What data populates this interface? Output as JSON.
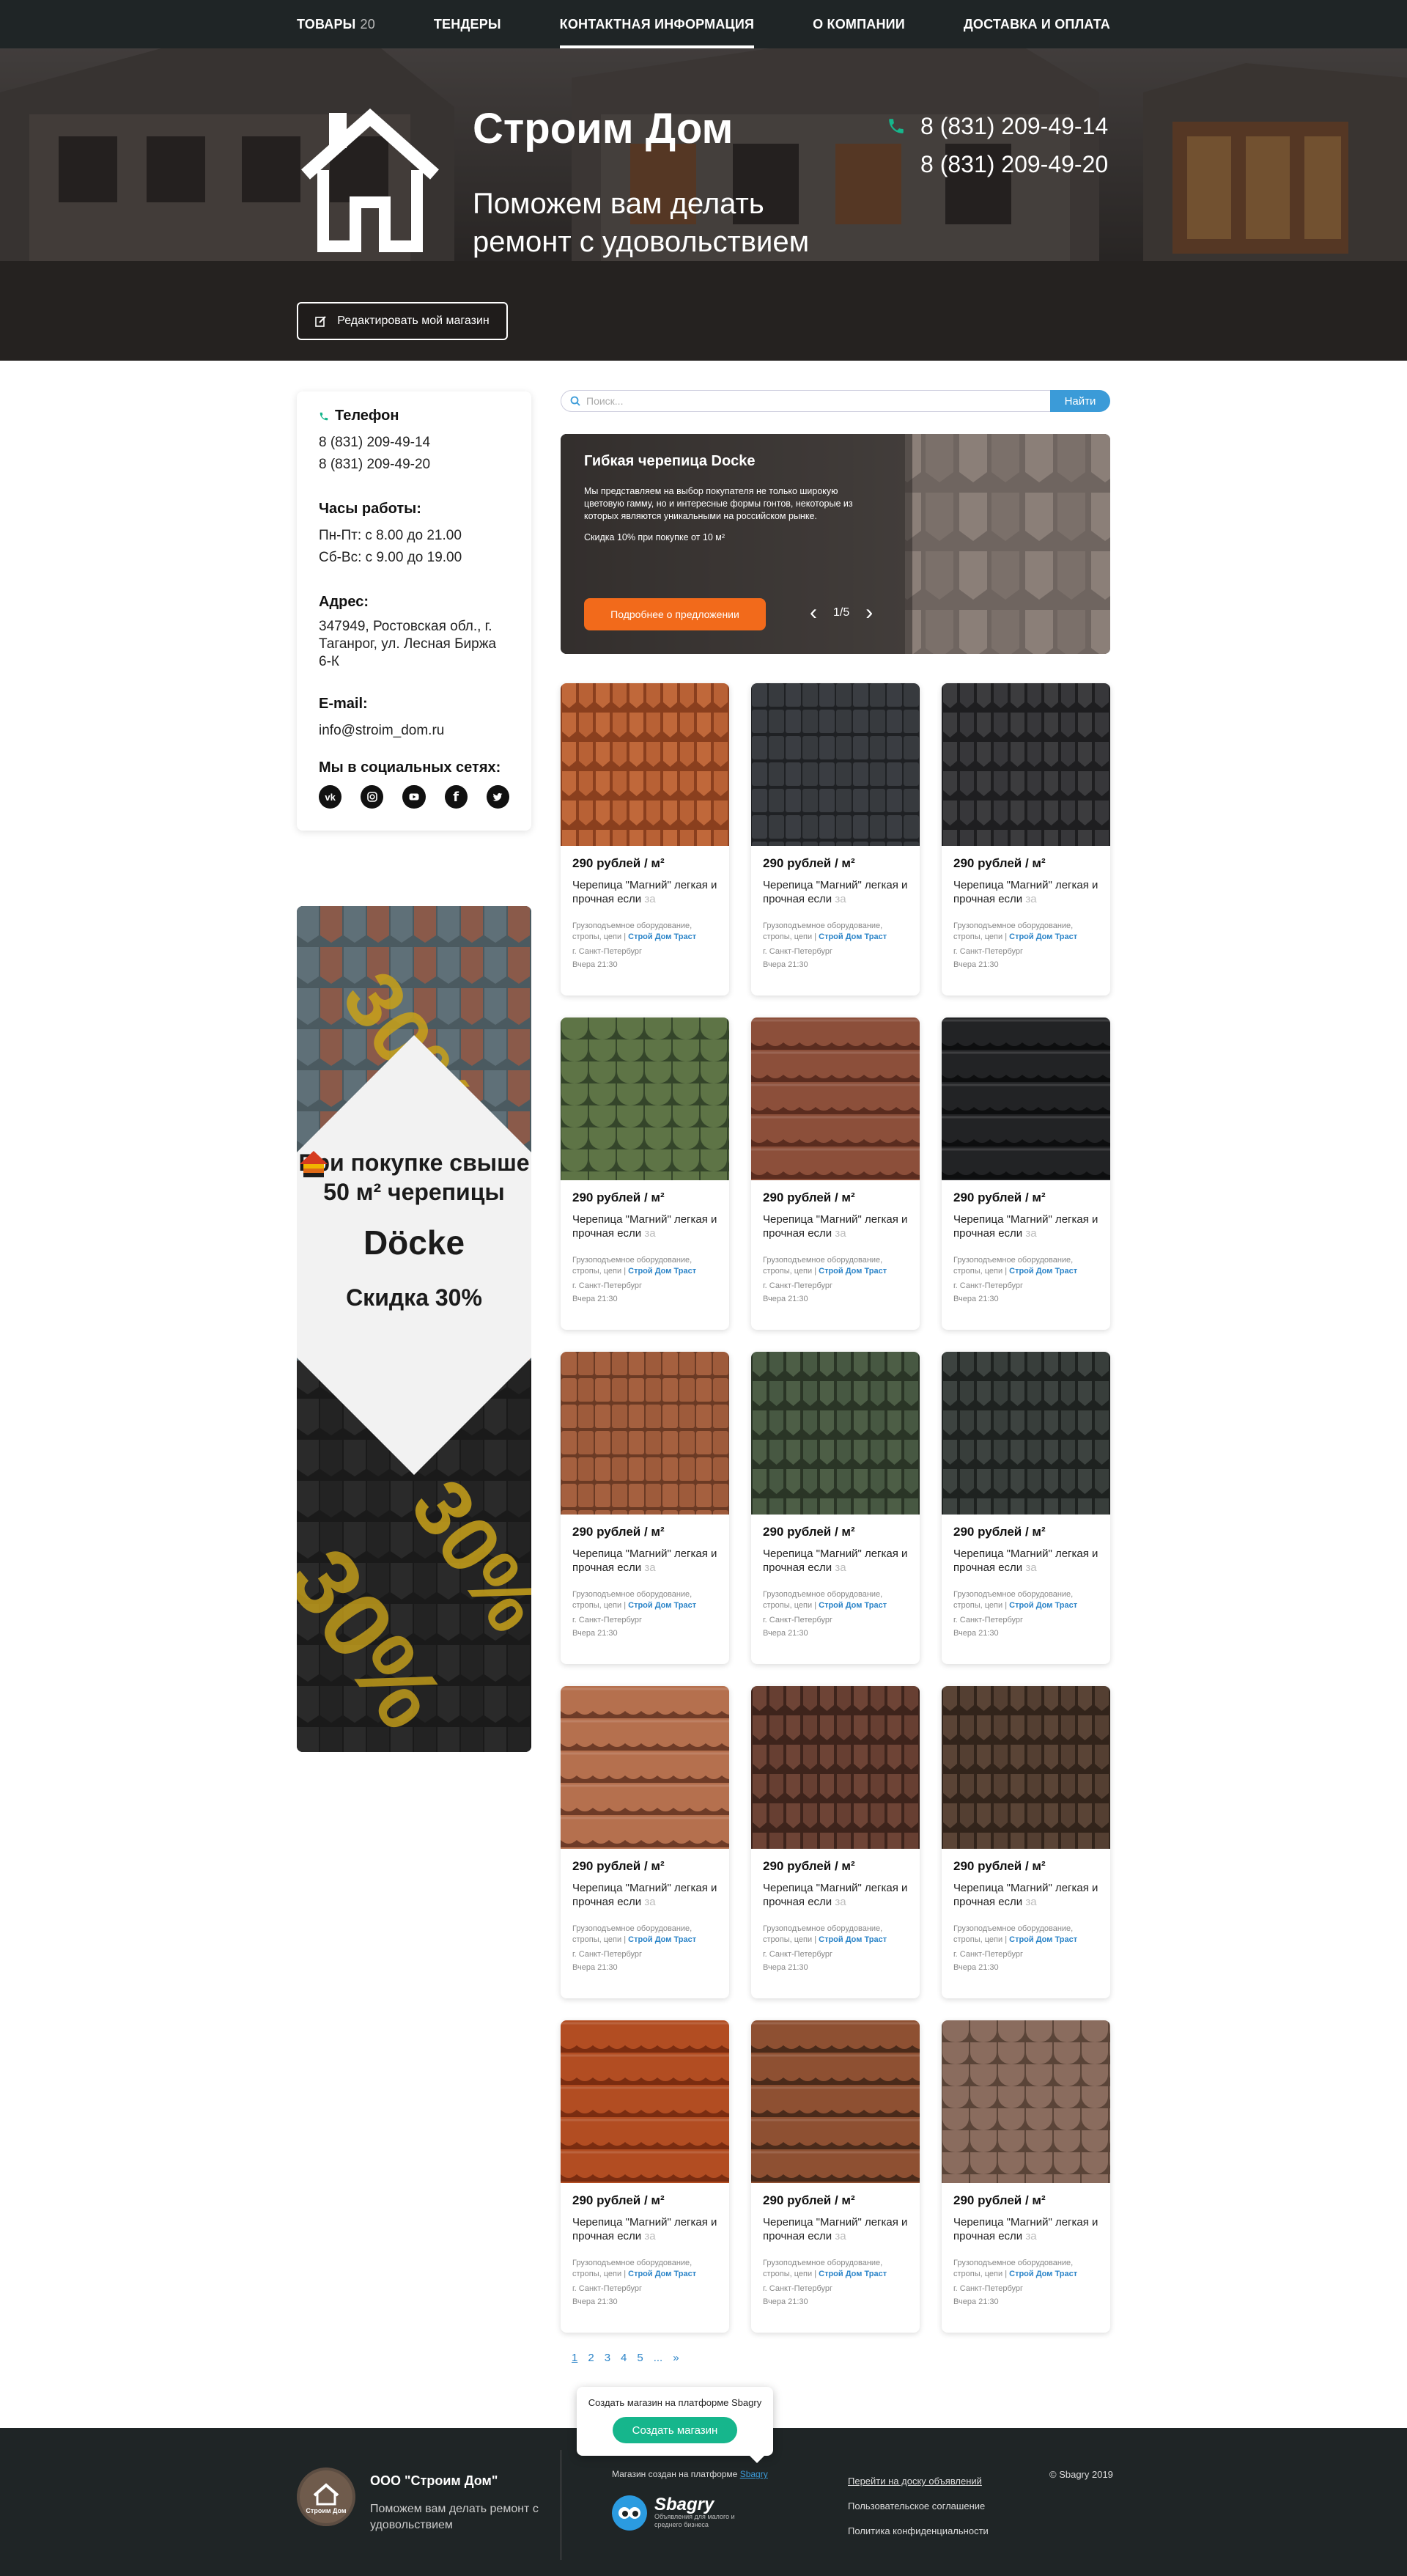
{
  "nav": {
    "items": [
      {
        "label": "ТОВАРЫ",
        "count": "20"
      },
      {
        "label": "ТЕНДЕРЫ"
      },
      {
        "label": "КОНТАКТНАЯ ИНФОРМАЦИЯ"
      },
      {
        "label": "О КОМПАНИИ"
      },
      {
        "label": "ДОСТАВКА И ОПЛАТА"
      }
    ]
  },
  "hero": {
    "brand": "Строим Дом",
    "slogan": "Поможем вам делать ремонт с удовольствием",
    "phone1": "8 (831) 209-49-14",
    "phone2": "8 (831) 209-49-20",
    "edit_label": "Редактировать мой магазин"
  },
  "sidebar": {
    "phone_heading": "Телефон",
    "phone1": "8 (831) 209-49-14",
    "phone2": "8 (831) 209-49-20",
    "hours_heading": "Часы работы:",
    "hours1": "Пн-Пт: с 8.00 до 21.00",
    "hours2": "Сб-Вс: с 9.00 до 19.00",
    "address_heading": "Адрес:",
    "address": "347949, Ростовская обл., г. Таганрог, ул. Лесная Биржа 6-К",
    "email_heading": "E-mail:",
    "email": "info@stroim_dom.ru",
    "social_heading": "Мы в социальных сетях:",
    "socials": [
      "vk-icon",
      "instagram-icon",
      "youtube-icon",
      "facebook-icon",
      "twitter-icon"
    ]
  },
  "promo": {
    "heading": "При покупке свыше 50 м² черепицы",
    "brand": "Döcke",
    "discount": "Скидка 30%",
    "watermark": "30%"
  },
  "search": {
    "placeholder": "Поиск...",
    "button": "Найти"
  },
  "slider": {
    "title": "Гибкая черепица Docke",
    "description": "Мы представляем на выбор покупателя не только широкую цветовую гамму, но и интересные формы гонтов, некоторые из которых являются уникальными на российском рынке.",
    "discount": "Скидка 10% при покупке от 10 м²",
    "button": "Подробнее о предложении",
    "counter": "1/5"
  },
  "product_common": {
    "price": "290 рублей / м²",
    "title_main": "Черепица \"Магний\" легкая и прочная если",
    "title_fade": "за",
    "category": "Грузоподъемное оборудование, стропы, цепи |",
    "seller": "Строй Дом Траст",
    "city": "г. Санкт-Петербург",
    "time": "Вчера 21:30"
  },
  "products": [
    {
      "price": "290 рублей / м²",
      "title": "Черепица \"Магний\" легкая и прочная если",
      "fade": "за",
      "category": "Грузоподъемное оборудование, стропы, цепи |",
      "seller": "Строй Дом Траст",
      "city": "г. Санкт-Петербург",
      "time": "Вчера 21:30",
      "color": "#c0683a",
      "accent": "#8a3f1e",
      "shape": "hex"
    },
    {
      "price": "290 рублей / м²",
      "title": "Черепица \"Магний\" легкая и прочная если",
      "fade": "за",
      "category": "Грузоподъемное оборудование, стропы, цепи |",
      "seller": "Строй Дом Траст",
      "city": "г. Санкт-Петербург",
      "time": "Вчера 21:30",
      "color": "#3a3d42",
      "accent": "#1f2124",
      "shape": "rect"
    },
    {
      "price": "290 рублей / м²",
      "title": "Черепица \"Магний\" легкая и прочная если",
      "fade": "за",
      "category": "Грузоподъемное оборудование, стропы, цепи |",
      "seller": "Строй Дом Траст",
      "city": "г. Санкт-Петербург",
      "time": "Вчера 21:30",
      "color": "#3c3c3e",
      "accent": "#1e1e20",
      "shape": "hex"
    },
    {
      "price": "290 рублей / м²",
      "title": "Черепица \"Магний\" легкая и прочная если",
      "fade": "за",
      "category": "Грузоподъемное оборудование, стропы, цепи |",
      "seller": "Строй Дом Траст",
      "city": "г. Санкт-Петербург",
      "time": "Вчера 21:30",
      "color": "#5e7446",
      "accent": "#34452a",
      "shape": "scale"
    },
    {
      "price": "290 рублей / м²",
      "title": "Черепица \"Магний\" легкая и прочная если",
      "fade": "за",
      "category": "Грузоподъемное оборудование, стропы, цепи |",
      "seller": "Строй Дом Траст",
      "city": "г. Санкт-Петербург",
      "time": "Вчера 21:30",
      "color": "#8c4f3a",
      "accent": "#5a2c1f",
      "shape": "wave"
    },
    {
      "price": "290 рублей / м²",
      "title": "Черепица \"Магний\" легкая и прочная если",
      "fade": "за",
      "category": "Грузоподъемное оборудование, стропы, цепи |",
      "seller": "Строй Дом Траст",
      "city": "г. Санкт-Петербург",
      "time": "Вчера 21:30",
      "color": "#222325",
      "accent": "#0d0e0f",
      "shape": "wave"
    },
    {
      "price": "290 рублей / м²",
      "title": "Черепица \"Магний\" легкая и прочная если",
      "fade": "за",
      "category": "Грузоподъемное оборудование, стропы, цепи |",
      "seller": "Строй Дом Траст",
      "city": "г. Санкт-Петербург",
      "time": "Вчера 21:30",
      "color": "#a5603f",
      "accent": "#6b3a24",
      "shape": "rect"
    },
    {
      "price": "290 рублей / м²",
      "title": "Черепица \"Магний\" легкая и прочная если",
      "fade": "за",
      "category": "Грузоподъемное оборудование, стропы, цепи |",
      "seller": "Строй Дом Траст",
      "city": "г. Санкт-Петербург",
      "time": "Вчера 21:30",
      "color": "#4d5e46",
      "accent": "#2a3526",
      "shape": "hex"
    },
    {
      "price": "290 рублей / м²",
      "title": "Черепица \"Магний\" легкая и прочная если",
      "fade": "за",
      "category": "Грузоподъемное оборудование, стропы, цепи |",
      "seller": "Строй Дом Траст",
      "city": "г. Санкт-Петербург",
      "time": "Вчера 21:30",
      "color": "#3d4340",
      "accent": "#1e2220",
      "shape": "hex"
    },
    {
      "price": "290 рублей / м²",
      "title": "Черепица \"Магний\" легкая и прочная если",
      "fade": "за",
      "category": "Грузоподъемное оборудование, стропы, цепи |",
      "seller": "Строй Дом Траст",
      "city": "г. Санкт-Петербург",
      "time": "Вчера 21:30",
      "color": "#b5704e",
      "accent": "#6e3b27",
      "shape": "wave"
    },
    {
      "price": "290 рублей / м²",
      "title": "Черепица \"Магний\" легкая и прочная если",
      "fade": "за",
      "category": "Грузоподъемное оборудование, стропы, цепи |",
      "seller": "Строй Дом Траст",
      "city": "г. Санкт-Петербург",
      "time": "Вчера 21:30",
      "color": "#6e4436",
      "accent": "#3e241c",
      "shape": "hex"
    },
    {
      "price": "290 рублей / м²",
      "title": "Черепица \"Магний\" легкая и прочная если",
      "fade": "за",
      "category": "Грузоподъемное оборудование, стропы, цепи |",
      "seller": "Строй Дом Траст",
      "city": "г. Санкт-Петербург",
      "time": "Вчера 21:30",
      "color": "#5a4436",
      "accent": "#32241b",
      "shape": "hex"
    },
    {
      "price": "290 рублей / м²",
      "title": "Черепица \"Магний\" легкая и прочная если",
      "fade": "за",
      "category": "Грузоподъемное оборудование, стропы, цепи |",
      "seller": "Строй Дом Траст",
      "city": "г. Санкт-Петербург",
      "time": "Вчера 21:30",
      "color": "#b24d22",
      "accent": "#7a2c10",
      "shape": "wave"
    },
    {
      "price": "290 рублей / м²",
      "title": "Черепица \"Магний\" легкая и прочная если",
      "fade": "за",
      "category": "Грузоподъемное оборудование, стропы, цепи |",
      "seller": "Строй Дом Траст",
      "city": "г. Санкт-Петербург",
      "time": "Вчера 21:30",
      "color": "#8e5032",
      "accent": "#4a2a1a",
      "shape": "wave"
    },
    {
      "price": "290 рублей / м²",
      "title": "Черепица \"Магний\" легкая и прочная если",
      "fade": "за",
      "category": "Грузоподъемное оборудование, стропы, цепи |",
      "seller": "Строй Дом Траст",
      "city": "г. Санкт-Петербург",
      "time": "Вчера 21:30",
      "color": "#8a6c5e",
      "accent": "#5a4438",
      "shape": "scale"
    }
  ],
  "pager": {
    "pages": [
      "1",
      "2",
      "3",
      "4",
      "5",
      "...",
      "»"
    ]
  },
  "footer": {
    "company": "ООО \"Строим Дом\"",
    "slogan": "Поможем вам делать ремонт с удовольствием",
    "logo_text": "Строим Дом",
    "made_on": "Магазин создан на платформе",
    "platform": "Sbagry",
    "platform_logo": "Sbagry",
    "platform_sub": "Объявления для малого и среднего бизнеса",
    "link1": "Перейти на доску объявлений",
    "link2": "Пользовательское соглашение",
    "link3": "Политика конфиденциальности",
    "copyright": "© Sbagry 2019"
  },
  "popup": {
    "text": "Создать магазин на платформе Sbagry",
    "button": "Создать магазин"
  },
  "colors": {
    "nav_bg": "#1f2526",
    "accent_blue": "#3b9bd8",
    "accent_orange": "#f26a1b",
    "accent_green": "#16b68c"
  }
}
